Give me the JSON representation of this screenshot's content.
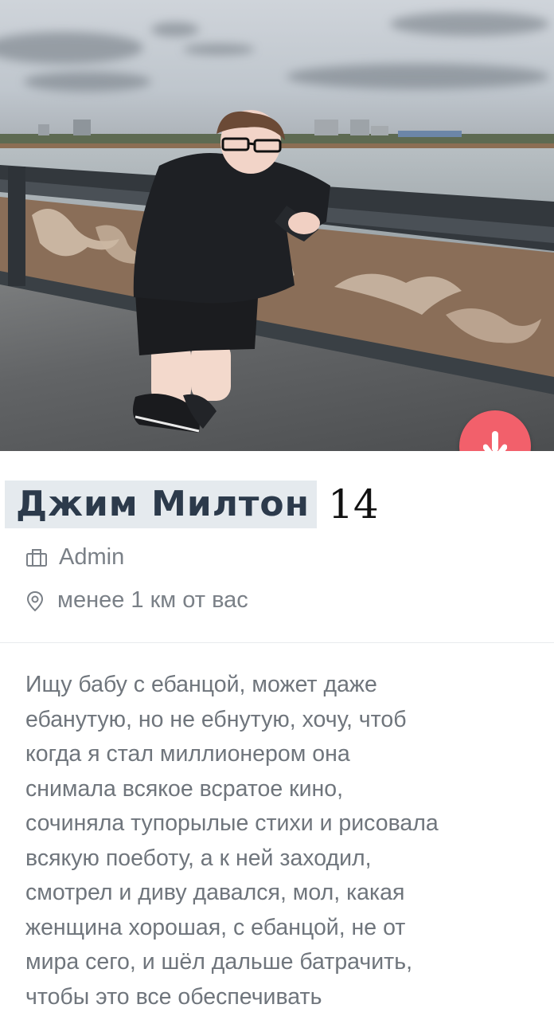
{
  "profile": {
    "name": "Джим Милтон",
    "age": "14",
    "job": "Admin",
    "distance": "менее 1 км от вас",
    "bio": "Ищу бабу с ебанцой, может даже\nебанутую, но не ебнутую, хочу, чтоб\nкогда я стал миллионером она\nснимала всякое всратое кино,\nсочиняла тупорылые стихи и рисовала\nвсякую поеботу, а к ней заходил,\nсмотрел и диву давался, мол, какая\nженщина хорошая, с ебанцой, не от\nмира сего, и шёл дальше батрачить,\nчтобы это все обеспечивать"
  },
  "icons": {
    "job": "briefcase-icon",
    "distance": "location-pin-icon",
    "dislike": "arrow-down-icon"
  },
  "colors": {
    "name_highlight": "#e5eaee",
    "name_text": "#2c3a4b",
    "meta_text": "#7a8087",
    "bio_text": "#6f757c",
    "dislike_button": "#f2606b"
  }
}
